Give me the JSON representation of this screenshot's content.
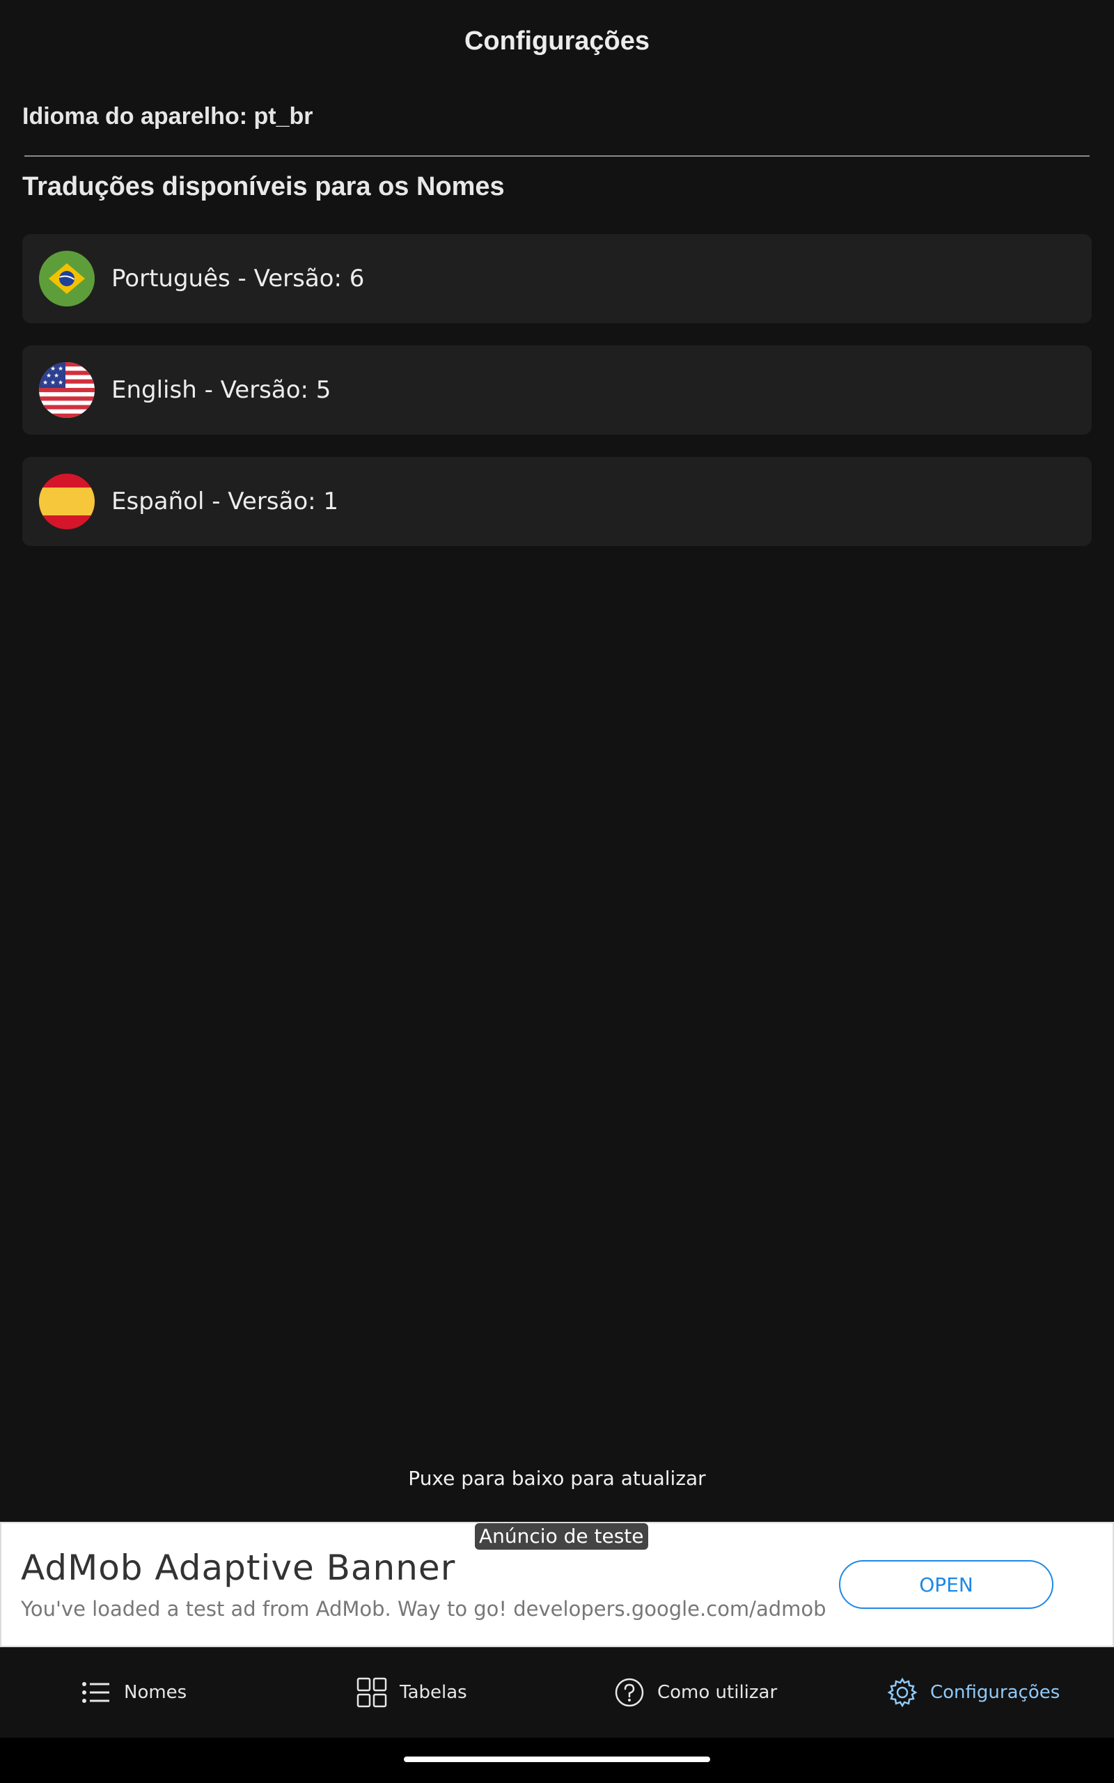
{
  "header": {
    "title": "Configurações"
  },
  "device_language": {
    "text": "Idioma do aparelho: pt_br"
  },
  "translations": {
    "section_title": "Traduções disponíveis para os Nomes",
    "items": [
      {
        "label": "Português - Versão: 6",
        "flag_icon": "brazil-flag-icon"
      },
      {
        "label": "English - Versão: 5",
        "flag_icon": "usa-flag-icon"
      },
      {
        "label": "Español - Versão: 1",
        "flag_icon": "spain-flag-icon"
      }
    ]
  },
  "refresh_hint": "Puxe para baixo para atualizar",
  "ad": {
    "tag": "Anúncio de teste",
    "title": "AdMob Adaptive Banner",
    "description": "You've loaded a test ad from AdMob. Way to go! developers.google.com/admob",
    "button_label": "OPEN",
    "accent_color": "#1e88e5"
  },
  "bottom_nav": {
    "items": [
      {
        "label": "Nomes",
        "icon": "list-icon",
        "active": false
      },
      {
        "label": "Tabelas",
        "icon": "grid-icon",
        "active": false
      },
      {
        "label": "Como utilizar",
        "icon": "help-circle-icon",
        "active": false
      },
      {
        "label": "Configurações",
        "icon": "gear-icon",
        "active": true
      }
    ],
    "active_color": "#90caf9"
  }
}
